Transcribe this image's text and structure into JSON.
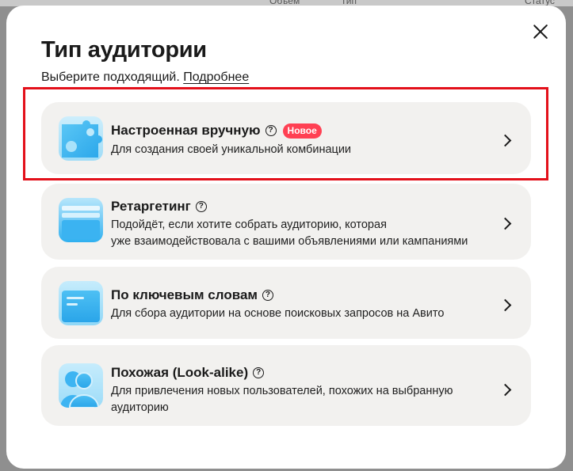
{
  "background": {
    "visible_text": [
      "Объём",
      "Тип",
      "Статус"
    ]
  },
  "modal": {
    "title": "Тип аудитории",
    "subtitle": "Выберите подходящий.",
    "more_link": "Подробнее",
    "close_icon": "close-icon"
  },
  "options": [
    {
      "title": "Настроенная вручную",
      "badge": "Новое",
      "description": "Для создания своей уникальной комбинации",
      "icon": "gear-puzzle-icon",
      "highlighted": true
    },
    {
      "title": "Ретаргетинг",
      "description_line1": "Подойдёт, если хотите собрать аудиторию, которая",
      "description_line2": "уже взаимодействовала с вашими объявлениями или кампаниями",
      "icon": "stack-icon"
    },
    {
      "title": "По ключевым словам",
      "description": "Для сбора аудитории на основе поисковых запросов на Авито",
      "icon": "keyword-window-icon"
    },
    {
      "title": "Похожая (Look-alike)",
      "description_line1": "Для привлечения новых пользователей, похожих на выбранную",
      "description_line2": "аудиторию",
      "icon": "people-icon"
    }
  ],
  "colors": {
    "badge": "#ff4053",
    "highlight_frame": "#e3101a",
    "card_bg": "#f2f1ef",
    "icon_blue": "#3fb6f0"
  }
}
